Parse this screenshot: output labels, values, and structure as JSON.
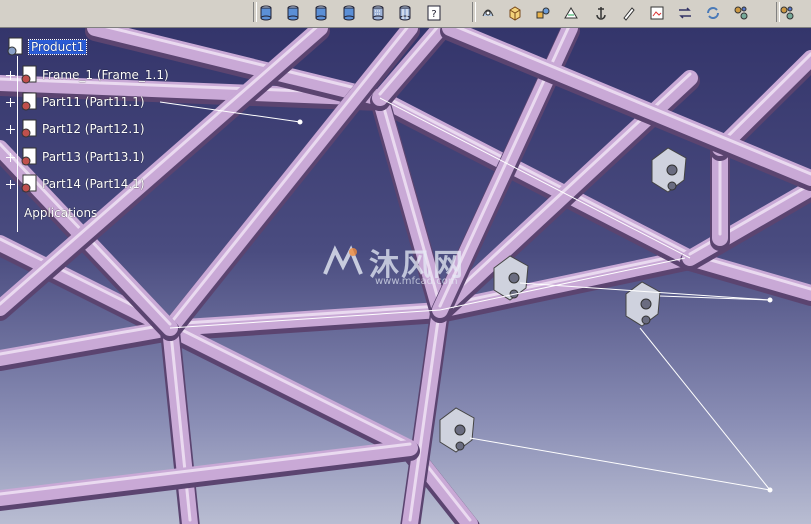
{
  "toolbar": {
    "buttons": [
      {
        "id": "cylinder-blue-1",
        "icon": "cylinder-icon"
      },
      {
        "id": "cylinder-blue-2",
        "icon": "cylinder-icon"
      },
      {
        "id": "cylinder-blue-3",
        "icon": "cylinder-icon"
      },
      {
        "id": "cylinder-blue-4",
        "icon": "cylinder-icon"
      },
      {
        "id": "cylinder-dotted",
        "icon": "cylinder-dotted-icon"
      },
      {
        "id": "cylinder-grid",
        "icon": "cylinder-grid-icon"
      },
      {
        "id": "help",
        "icon": "help-icon"
      },
      {
        "id": "tool-1",
        "icon": "bolt-icon"
      },
      {
        "id": "tool-2",
        "icon": "cube-icon"
      },
      {
        "id": "tool-3",
        "icon": "shapes-icon"
      },
      {
        "id": "tool-4",
        "icon": "measure-icon"
      },
      {
        "id": "tool-5",
        "icon": "anchor-icon"
      },
      {
        "id": "tool-6",
        "icon": "pen-icon"
      },
      {
        "id": "tool-7",
        "icon": "image-icon"
      },
      {
        "id": "tool-8",
        "icon": "switch-icon"
      },
      {
        "id": "tool-9",
        "icon": "refresh-icon"
      },
      {
        "id": "tool-10",
        "icon": "grid-icon"
      },
      {
        "id": "tool-11",
        "icon": "gears-icon"
      }
    ]
  },
  "tree": {
    "root": "Product1",
    "items": [
      {
        "label": "Frame_1 (Frame_1.1)"
      },
      {
        "label": "Part11 (Part11.1)"
      },
      {
        "label": "Part12 (Part12.1)"
      },
      {
        "label": "Part13 (Part13.1)"
      },
      {
        "label": "Part14 (Part14.1)"
      }
    ],
    "applications": "Applications"
  },
  "watermark": {
    "text": "沐风网",
    "url": "www.mfcad.com"
  },
  "colors": {
    "tube": "#c9a9d6",
    "tube_shadow": "#5b4470",
    "background_top": "#34356b",
    "background_bottom": "#b9bdd2",
    "selection": "#2a5bd6"
  }
}
